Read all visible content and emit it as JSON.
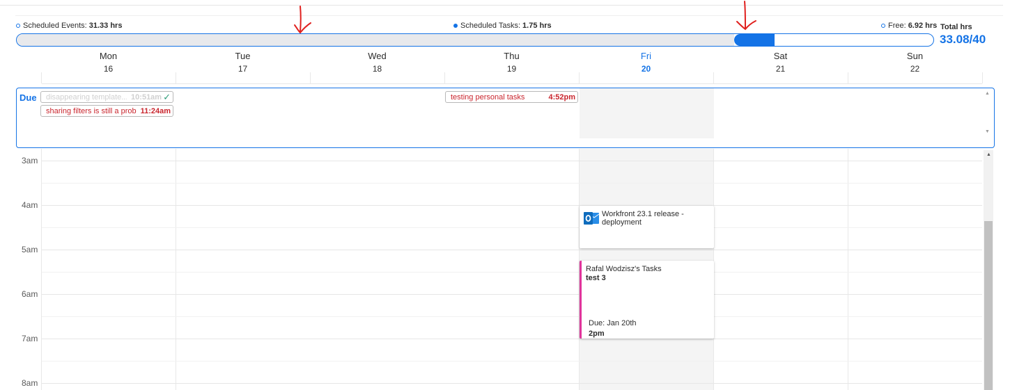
{
  "summary": {
    "events_label": "Scheduled Events:",
    "events_value": "31.33 hrs",
    "tasks_label": "Scheduled Tasks:",
    "tasks_value": "1.75 hrs",
    "free_label": "Free:",
    "free_value": "6.92 hrs",
    "total_label": "Total hrs",
    "total_value": "33.08/40"
  },
  "progress": {
    "events_fraction": 0.783,
    "tasks_fraction": 0.044
  },
  "days": [
    {
      "name": "Mon",
      "num": "16"
    },
    {
      "name": "Tue",
      "num": "17"
    },
    {
      "name": "Wed",
      "num": "18"
    },
    {
      "name": "Thu",
      "num": "19"
    },
    {
      "name": "Fri",
      "num": "20",
      "today": true
    },
    {
      "name": "Sat",
      "num": "21"
    },
    {
      "name": "Sun",
      "num": "22"
    }
  ],
  "due": {
    "label": "Due",
    "items": [
      {
        "title": "disappearing template...",
        "time": "10:51am",
        "status": "done"
      },
      {
        "title": "sharing filters is still a prob...",
        "time": "11:24am",
        "status": "late"
      },
      {
        "title": "testing personal tasks",
        "time": "4:52pm",
        "status": "late"
      }
    ]
  },
  "hours": [
    "3am",
    "4am",
    "5am",
    "6am",
    "7am",
    "8am"
  ],
  "events": [
    {
      "title": "Workfront 23.1 release - deployment",
      "icon": "outlook-icon"
    }
  ],
  "tasks": [
    {
      "owner": "Rafal Wodzisz's Tasks",
      "name": "test 3",
      "due": "Due: Jan 20th",
      "time": "2pm"
    }
  ],
  "colors": {
    "accent": "#1473e6",
    "task_stripe": "#e0339b",
    "late": "#c9252d",
    "annotation": "#e0201e"
  }
}
